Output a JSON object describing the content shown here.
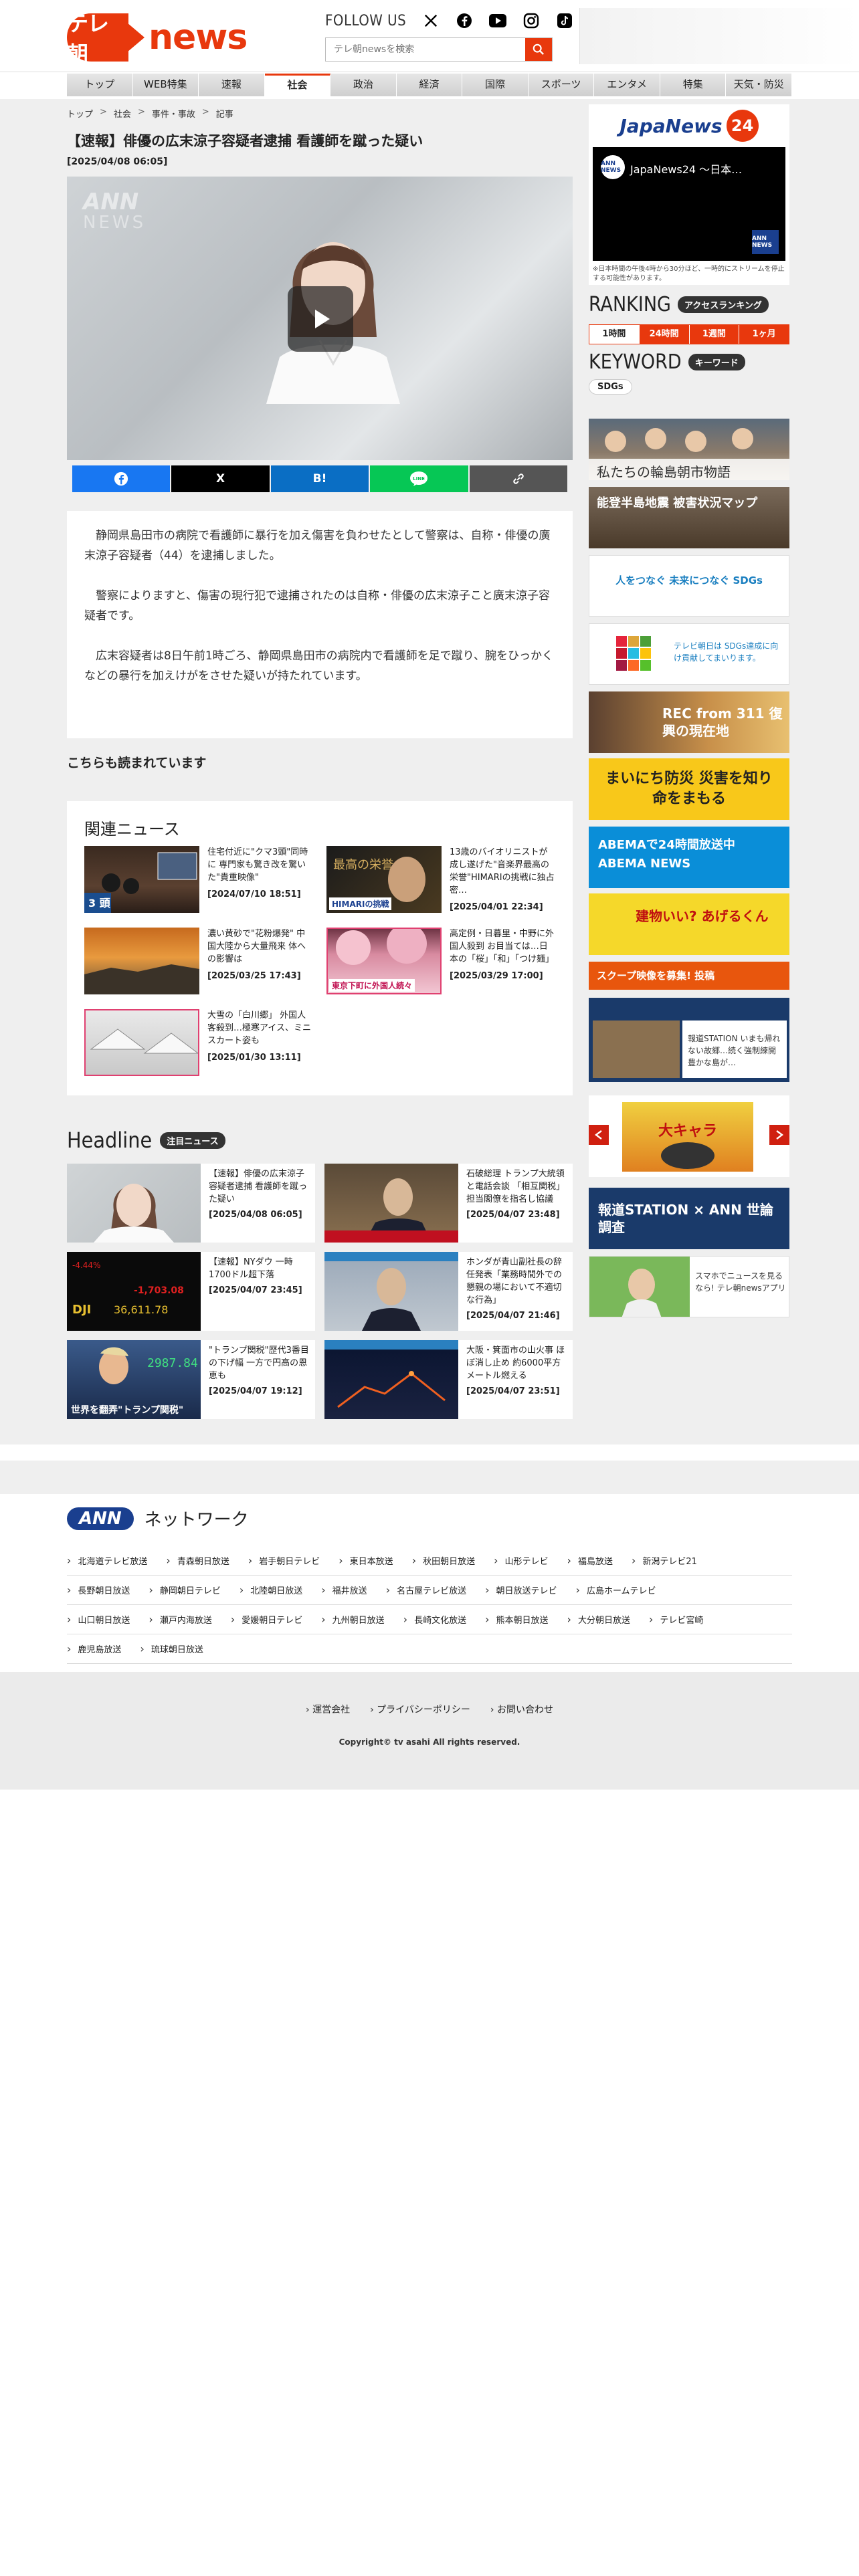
{
  "header": {
    "logo_badge": "テレ朝",
    "logo_text": "news",
    "follow_label": "FOLLOW US",
    "search_placeholder": "テレ朝newsを検索"
  },
  "nav": [
    "トップ",
    "WEB特集",
    "速報",
    "社会",
    "政治",
    "経済",
    "国際",
    "スポーツ",
    "エンタメ",
    "特集",
    "天気・防災"
  ],
  "nav_active": "社会",
  "breadcrumb": [
    "トップ",
    "社会",
    "事件・事故",
    "記事"
  ],
  "article": {
    "title": "【速報】俳優の広末涼子容疑者逮捕 看護師を蹴った疑い",
    "date": "[2025/04/08 06:05]",
    "video_watermark": "ANN",
    "video_watermark2": "NEWS",
    "share": [
      "f",
      "X",
      "B!",
      "LINE",
      "🔗"
    ],
    "paragraphs": [
      "静岡県島田市の病院で看護師に暴行を加え傷害を負わせたとして警察は、自称・俳優の廣末涼子容疑者（44）を逮捕しました。",
      "警察によりますと、傷害の現行犯で逮捕されたのは自称・俳優の広末涼子こと廣末涼子容疑者です。",
      "広末容疑者は8日午前1時ごろ、静岡県島田市の病院内で看護師を足で蹴り、腕をひっかくなどの暴行を加えけがをさせた疑いが持たれています。"
    ]
  },
  "also_read": "こちらも読まれています",
  "related": {
    "title": "関連ニュース",
    "items": [
      {
        "text": "住宅付近に\"クマ3頭\"同時に 専門家も驚き改を驚いた\"貴重映像\"",
        "date": "[2024/07/10 18:51]",
        "thumb_label": "3 頭"
      },
      {
        "text": "13歳のバイオリニストが成し遂げた\"音楽界最高の栄誉\"HIMARIの挑戦に独占密…",
        "date": "[2025/04/01 22:34]",
        "thumb_label": "HIMARIの挑戦"
      },
      {
        "text": "濃い黄砂で\"花粉爆発\" 中国大陸から大量飛来 体への影響は",
        "date": "[2025/03/25 17:43]",
        "thumb_label": ""
      },
      {
        "text": "高定例・日暮里・中野に外国人殺到 お目当ては…日本の「桜」「和」「つけ麺」",
        "date": "[2025/03/29 17:00]",
        "thumb_label": "東京下町に外国人続々"
      },
      {
        "text": "大雪の「白川郷」 外国人客殺到…極寒アイス、ミニスカート姿も",
        "date": "[2025/01/30 13:11]",
        "thumb_label": ""
      }
    ]
  },
  "headline": {
    "title": "Headline",
    "tag": "注目ニュース",
    "items": [
      {
        "text": "【速報】俳優の広末涼子容疑者逮捕 看護師を蹴った疑い",
        "date": "[2025/04/08 06:05]",
        "thumb_label": ""
      },
      {
        "text": "石破総理 トランプ大統領と電話会談 「相互関税」担当閣僚を指名し協議",
        "date": "[2025/04/07 23:48]",
        "thumb_label": ""
      },
      {
        "text": "【速報】NYダウ 一時1700ドル超下落",
        "date": "[2025/04/07 23:45]",
        "thumb_label": "-1,703.08"
      },
      {
        "text": "ホンダが青山副社長の辞任発表「業務時間外での懇親の場において不適切な行為」",
        "date": "[2025/04/07 21:46]",
        "thumb_label": ""
      },
      {
        "text": "\"トランプ関税\"歴代3番目の下げ幅 一方で円高の恩恵も",
        "date": "[2025/04/07 19:12]",
        "thumb_label": "世界を翻弄\"トランプ関税\""
      },
      {
        "text": "大阪・箕面市の山火事 ほぼ消し止め 約6000平方メートル燃える",
        "date": "[2025/04/07 23:51]",
        "thumb_label": ""
      }
    ]
  },
  "sidebar": {
    "jn24_logo": "JapaNews",
    "jn24_num": "24",
    "jn24_title": "JapaNews24 〜日本…",
    "jn24_ch": "ANN NEWS",
    "jn24_note": "※日本時間の午後4時から30分ほど、一時的にストリームを停止する可能性があります。",
    "ranking_title": "RANKING",
    "ranking_tag": "アクセスランキング",
    "ranking_tabs": [
      "1時間",
      "24時間",
      "1週間",
      "1ヶ月"
    ],
    "ranking_active": "1時間",
    "keyword_title": "KEYWORD",
    "keyword_tag": "キーワード",
    "keywords": [
      "SDGs"
    ],
    "banners": [
      {
        "label": "私たちの輪島朝市物語"
      },
      {
        "label": "能登半島地震 被害状況マップ"
      },
      {
        "label": "人をつなぐ 未来につなぐ SDGs"
      },
      {
        "label": "テレビ朝日は SDGs達成に向け貢献してまいります。"
      },
      {
        "label": "REC from 311 復興の現在地"
      },
      {
        "label": "まいにち防災 災害を知り 命をまもる"
      },
      {
        "label": "ABEMAで24時間放送中 ABEMA NEWS"
      },
      {
        "label": "建物いい? あげるくん"
      },
      {
        "label": "スクープ映像を募集! 投稿"
      },
      {
        "label": "報道STATION いまも帰れない故郷…続く強制練開 豊かな島が…"
      },
      {
        "label": "報道STATION × ANN 世論調査"
      },
      {
        "label": "スマホでニュースを見るなら! テレ朝newsアプリ"
      }
    ]
  },
  "ann": {
    "logo": "ANN",
    "title": "ネットワーク",
    "rows": [
      [
        "北海道テレビ放送",
        "青森朝日放送",
        "岩手朝日テレビ",
        "東日本放送",
        "秋田朝日放送",
        "山形テレビ",
        "福島放送",
        "新潟テレビ21"
      ],
      [
        "長野朝日放送",
        "静岡朝日テレビ",
        "北陸朝日放送",
        "福井放送",
        "名古屋テレビ放送",
        "朝日放送テレビ",
        "広島ホームテレビ"
      ],
      [
        "山口朝日放送",
        "瀬戸内海放送",
        "愛媛朝日テレビ",
        "九州朝日放送",
        "長崎文化放送",
        "熊本朝日放送",
        "大分朝日放送",
        "テレビ宮崎"
      ],
      [
        "鹿児島放送",
        "琉球朝日放送"
      ]
    ]
  },
  "footer": {
    "links": [
      "運営会社",
      "プライバシーポリシー",
      "お問い合わせ"
    ],
    "copyright": "Copyright© tv asahi All rights reserved."
  },
  "colors": {
    "brand": "#e8380d",
    "ann_blue": "#1a3f8f",
    "facebook": "#1877f2",
    "x": "#000000",
    "hatena": "#0a6ec4",
    "line": "#06c755",
    "link": "#555555"
  }
}
